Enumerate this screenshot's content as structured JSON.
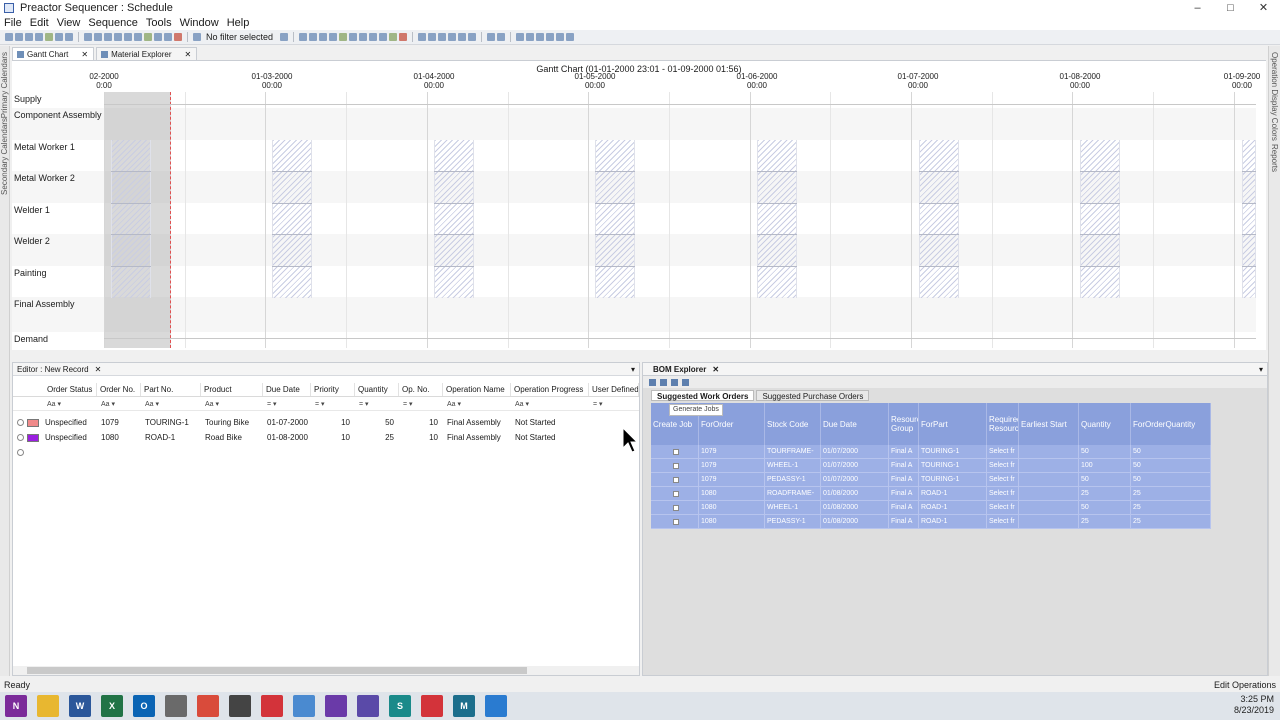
{
  "window": {
    "title": "Preactor Sequencer : Schedule",
    "min": "–",
    "max": "□",
    "close": "✕"
  },
  "menu": [
    "File",
    "Edit",
    "View",
    "Sequence",
    "Tools",
    "Window",
    "Help"
  ],
  "toolbar": {
    "filter_label": "No filter selected"
  },
  "left_tabs": [
    "Primary Calendars",
    "Secondary Calendars"
  ],
  "right_tabs": [
    "Operation Display Colors",
    "Reports"
  ],
  "doc_tabs": [
    {
      "label": "Gantt Chart",
      "close": "✕"
    },
    {
      "label": "Material Explorer",
      "close": "✕"
    }
  ],
  "gantt": {
    "title": "Gantt Chart    (01-01-2000 23:01 - 01-09-2000 01:56)",
    "dates": [
      {
        "date": "02-2000",
        "time": "0:00"
      },
      {
        "date": "01-03-2000",
        "time": "00:00"
      },
      {
        "date": "01-04-2000",
        "time": "00:00"
      },
      {
        "date": "01-05-2000",
        "time": "00:00"
      },
      {
        "date": "01-06-2000",
        "time": "00:00"
      },
      {
        "date": "01-07-2000",
        "time": "00:00"
      },
      {
        "date": "01-08-2000",
        "time": "00:00"
      },
      {
        "date": "01-09-200",
        "time": "00:00"
      }
    ],
    "rows": [
      "Supply",
      "Component Assembly",
      "Metal Worker 1",
      "Metal Worker 2",
      "Welder 1",
      "Welder 2",
      "Painting",
      "Final Assembly",
      "Demand"
    ]
  },
  "editor": {
    "title": "Editor : New Record",
    "close": "✕",
    "dropdown": "▾",
    "columns": [
      "Order Status",
      "Order No.",
      "Part No.",
      "Product",
      "Due Date",
      "Priority",
      "Quantity",
      "Op. No.",
      "Operation Name",
      "Operation Progress",
      "User Defined"
    ],
    "filters": [
      "Aa",
      "Aa",
      "Aa",
      "Aa",
      "=",
      "=",
      "=",
      "=",
      "Aa",
      "Aa",
      "="
    ],
    "rows": [
      {
        "status": "Unspecified",
        "order": "1079",
        "part": "TOURING-1",
        "product": "Touring Bike",
        "due": "01-07-2000",
        "priority": "10",
        "qty": "50",
        "op": "10",
        "opname": "Final Assembly",
        "progress": "Not Started",
        "color": "#f08a8a"
      },
      {
        "status": "Unspecified",
        "order": "1080",
        "part": "ROAD-1",
        "product": "Road Bike",
        "due": "01-08-2000",
        "priority": "10",
        "qty": "25",
        "op": "10",
        "opname": "Final Assembly",
        "progress": "Not Started",
        "color": "#9a1fe0"
      }
    ]
  },
  "bom": {
    "title": "BOM Explorer",
    "close": "✕",
    "dropdown": "▾",
    "tabs": [
      "Suggested Work Orders",
      "Suggested Purchase Orders"
    ],
    "tooltip": "Generate Jobs",
    "columns": [
      "Create Job",
      "ForOrder",
      "Stock Code",
      "Due Date",
      "Resource Group",
      "ForPart",
      "Required Resource",
      "Earliest Start",
      "Quantity",
      "ForOrderQuantity"
    ],
    "rows": [
      {
        "order": "1079",
        "stock": "TOURFRAME-",
        "due": "01/07/2000",
        "group": "Final A",
        "part": "TOURING-1",
        "res": "Select fr",
        "start": "",
        "qty": "50",
        "oq": "50"
      },
      {
        "order": "1079",
        "stock": "WHEEL-1",
        "due": "01/07/2000",
        "group": "Final A",
        "part": "TOURING-1",
        "res": "Select fr",
        "start": "",
        "qty": "100",
        "oq": "50"
      },
      {
        "order": "1079",
        "stock": "PEDASSY-1",
        "due": "01/07/2000",
        "group": "Final A",
        "part": "TOURING-1",
        "res": "Select fr",
        "start": "",
        "qty": "50",
        "oq": "50"
      },
      {
        "order": "1080",
        "stock": "ROADFRAME-",
        "due": "01/08/2000",
        "group": "Final A",
        "part": "ROAD-1",
        "res": "Select fr",
        "start": "",
        "qty": "25",
        "oq": "25"
      },
      {
        "order": "1080",
        "stock": "WHEEL-1",
        "due": "01/08/2000",
        "group": "Final A",
        "part": "ROAD-1",
        "res": "Select fr",
        "start": "",
        "qty": "50",
        "oq": "25"
      },
      {
        "order": "1080",
        "stock": "PEDASSY-1",
        "due": "01/08/2000",
        "group": "Final A",
        "part": "ROAD-1",
        "res": "Select fr",
        "start": "",
        "qty": "25",
        "oq": "25"
      }
    ]
  },
  "status": {
    "left": "Ready",
    "right": "Edit Operations"
  },
  "taskbar": {
    "apps": [
      {
        "name": "onenote",
        "label": "N",
        "color": "#7b2b9a"
      },
      {
        "name": "file-explorer",
        "label": "",
        "color": "#e8b730"
      },
      {
        "name": "word",
        "label": "W",
        "color": "#2b579a"
      },
      {
        "name": "excel",
        "label": "X",
        "color": "#217346"
      },
      {
        "name": "outlook",
        "label": "O",
        "color": "#0a64b4"
      },
      {
        "name": "tools",
        "label": "",
        "color": "#6a6a6a"
      },
      {
        "name": "chrome",
        "label": "",
        "color": "#d94b3b"
      },
      {
        "name": "calculator",
        "label": "",
        "color": "#444444"
      },
      {
        "name": "preactor",
        "label": "",
        "color": "#d3333a"
      },
      {
        "name": "app-blue",
        "label": "",
        "color": "#4a8ad0"
      },
      {
        "name": "visual-studio",
        "label": "",
        "color": "#6a3aa8"
      },
      {
        "name": "vs-tools",
        "label": "",
        "color": "#5a4aa8"
      },
      {
        "name": "sql",
        "label": "S",
        "color": "#1a8a8a"
      },
      {
        "name": "preactor-2",
        "label": "",
        "color": "#d3333a"
      },
      {
        "name": "app-m",
        "label": "M",
        "color": "#1c6e8c"
      },
      {
        "name": "app-cam",
        "label": "",
        "color": "#2a7bd0"
      }
    ],
    "time": "3:25 PM",
    "date": "8/23/2019"
  }
}
